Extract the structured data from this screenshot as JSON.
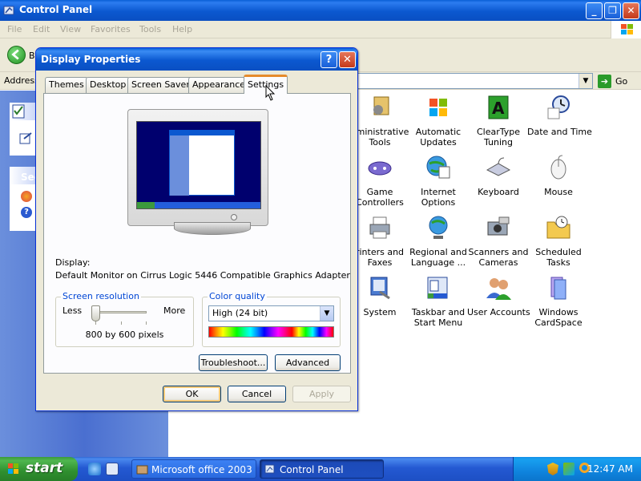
{
  "control_panel": {
    "title": "Control Panel",
    "menu": [
      "File",
      "Edit",
      "View",
      "Favorites",
      "Tools",
      "Help"
    ],
    "toolbar": {
      "back_label": "B"
    },
    "address": {
      "label": "Address",
      "go_label": "Go"
    },
    "taskpane": {
      "see_label": "See"
    },
    "items": [
      [
        "dministrative",
        "Tools"
      ],
      [
        "Automatic",
        "Updates"
      ],
      [
        "ClearType",
        "Tuning"
      ],
      [
        "Date and Time",
        ""
      ],
      [
        "Game",
        "Controllers"
      ],
      [
        "Internet",
        "Options"
      ],
      [
        "Keyboard",
        ""
      ],
      [
        "Mouse",
        ""
      ],
      [
        "rinters and",
        "Faxes"
      ],
      [
        "Regional and",
        "Language ..."
      ],
      [
        "Scanners and",
        "Cameras"
      ],
      [
        "Scheduled",
        "Tasks"
      ],
      [
        "System",
        ""
      ],
      [
        "Taskbar and",
        "Start Menu"
      ],
      [
        "User Accounts",
        ""
      ],
      [
        "Windows",
        "CardSpace"
      ]
    ]
  },
  "dialog": {
    "title": "Display Properties",
    "help_label": "?",
    "close_label": "✕",
    "tabs": [
      "Themes",
      "Desktop",
      "Screen Saver",
      "Appearance",
      "Settings"
    ],
    "active_tab": "Settings",
    "display_label": "Display:",
    "display_value": "Default Monitor on Cirrus Logic 5446 Compatible Graphics Adapter",
    "resolution": {
      "title": "Screen resolution",
      "less": "Less",
      "more": "More",
      "value": "800 by 600 pixels",
      "slider_position": 0
    },
    "color_quality": {
      "title": "Color quality",
      "value": "High (24 bit)"
    },
    "buttons": {
      "troubleshoot": "Troubleshoot...",
      "advanced": "Advanced",
      "ok": "OK",
      "cancel": "Cancel",
      "apply": "Apply"
    }
  },
  "taskbar": {
    "start_label": "start",
    "tasks": [
      "Microsoft office 2003 ...",
      "Control Panel"
    ],
    "clock": "12:47 AM"
  },
  "colors": {
    "xp_blue": "#0b58d0",
    "start_green": "#3c9a3c",
    "tab_highlight": "#e68b2c",
    "group_title": "#0046d5"
  }
}
